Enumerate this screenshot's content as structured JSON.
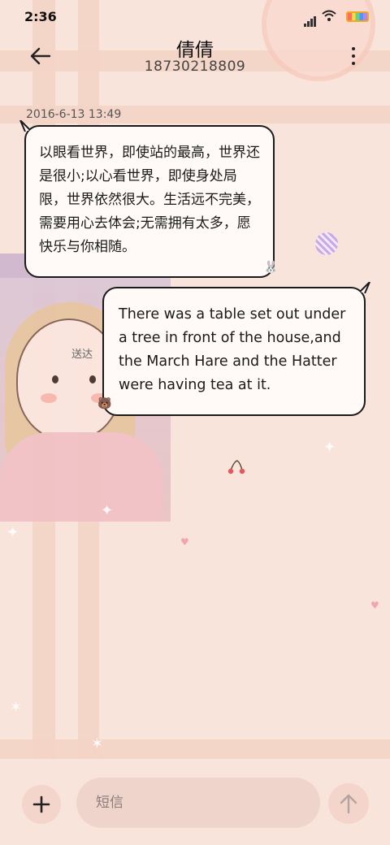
{
  "status_bar": {
    "time": "2:36"
  },
  "header": {
    "contact_name": "倩倩",
    "contact_number": "18730218809"
  },
  "conversation": {
    "timestamp": "2016-6-13 13:49",
    "messages": [
      {
        "direction": "incoming",
        "text": "以眼看世界，即使站的最高，世界还是很小;以心看世界，即使身处局限，世界依然很大。生活远不完美，需要用心去体会;无需拥有太多，愿快乐与你相随。"
      },
      {
        "direction": "outgoing",
        "text": "There was a table set out under a tree in front of the house,and the March Hare and the Hatter were having tea at it.",
        "status": "送达"
      }
    ]
  },
  "composer": {
    "placeholder": "短信",
    "add_icon": "plus-icon",
    "send_icon": "arrow-up-icon"
  },
  "colors": {
    "background": "#f9e4dc",
    "bubble_fill": "#fffaf7",
    "bubble_border": "#1a1a1a",
    "stripe": "#f3d3c6"
  }
}
